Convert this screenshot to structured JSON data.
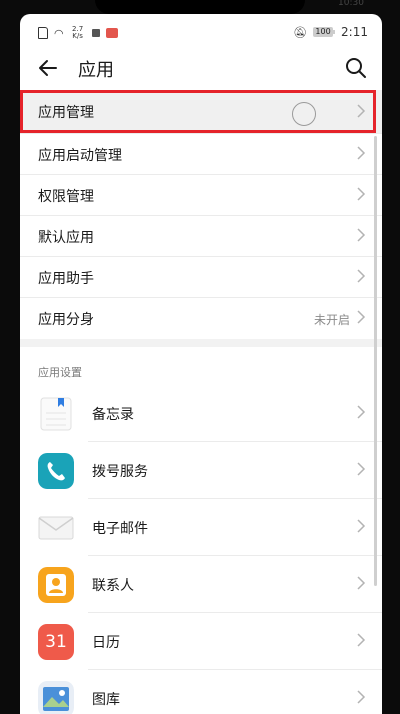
{
  "top_edge": {
    "time_text": "10:30",
    "left_icons": "• • •"
  },
  "status_bar": {
    "net_speed": "2.7\nK/s",
    "battery": "100",
    "time": "2:11"
  },
  "app_bar": {
    "title": "应用"
  },
  "menu_items": [
    {
      "label": "应用管理",
      "value": ""
    },
    {
      "label": "应用启动管理",
      "value": ""
    },
    {
      "label": "权限管理",
      "value": ""
    },
    {
      "label": "默认应用",
      "value": ""
    },
    {
      "label": "应用助手",
      "value": ""
    },
    {
      "label": "应用分身",
      "value": "未开启"
    }
  ],
  "section_header": "应用设置",
  "apps": [
    {
      "label": "备忘录",
      "icon": "notes-icon",
      "color": "#ffffff"
    },
    {
      "label": "拨号服务",
      "icon": "phone-icon",
      "color": "#1aa3b8"
    },
    {
      "label": "电子邮件",
      "icon": "email-icon",
      "color": "#f4f4f4"
    },
    {
      "label": "联系人",
      "icon": "contacts-icon",
      "color": "#f7a41d"
    },
    {
      "label": "日历",
      "icon": "calendar-icon",
      "color": "#ef5a4a",
      "icon_text": "31"
    },
    {
      "label": "图库",
      "icon": "gallery-icon",
      "color": "#4a90d9"
    }
  ],
  "colors": {
    "highlight_border": "#e5232a",
    "divider": "#ebebeb"
  }
}
